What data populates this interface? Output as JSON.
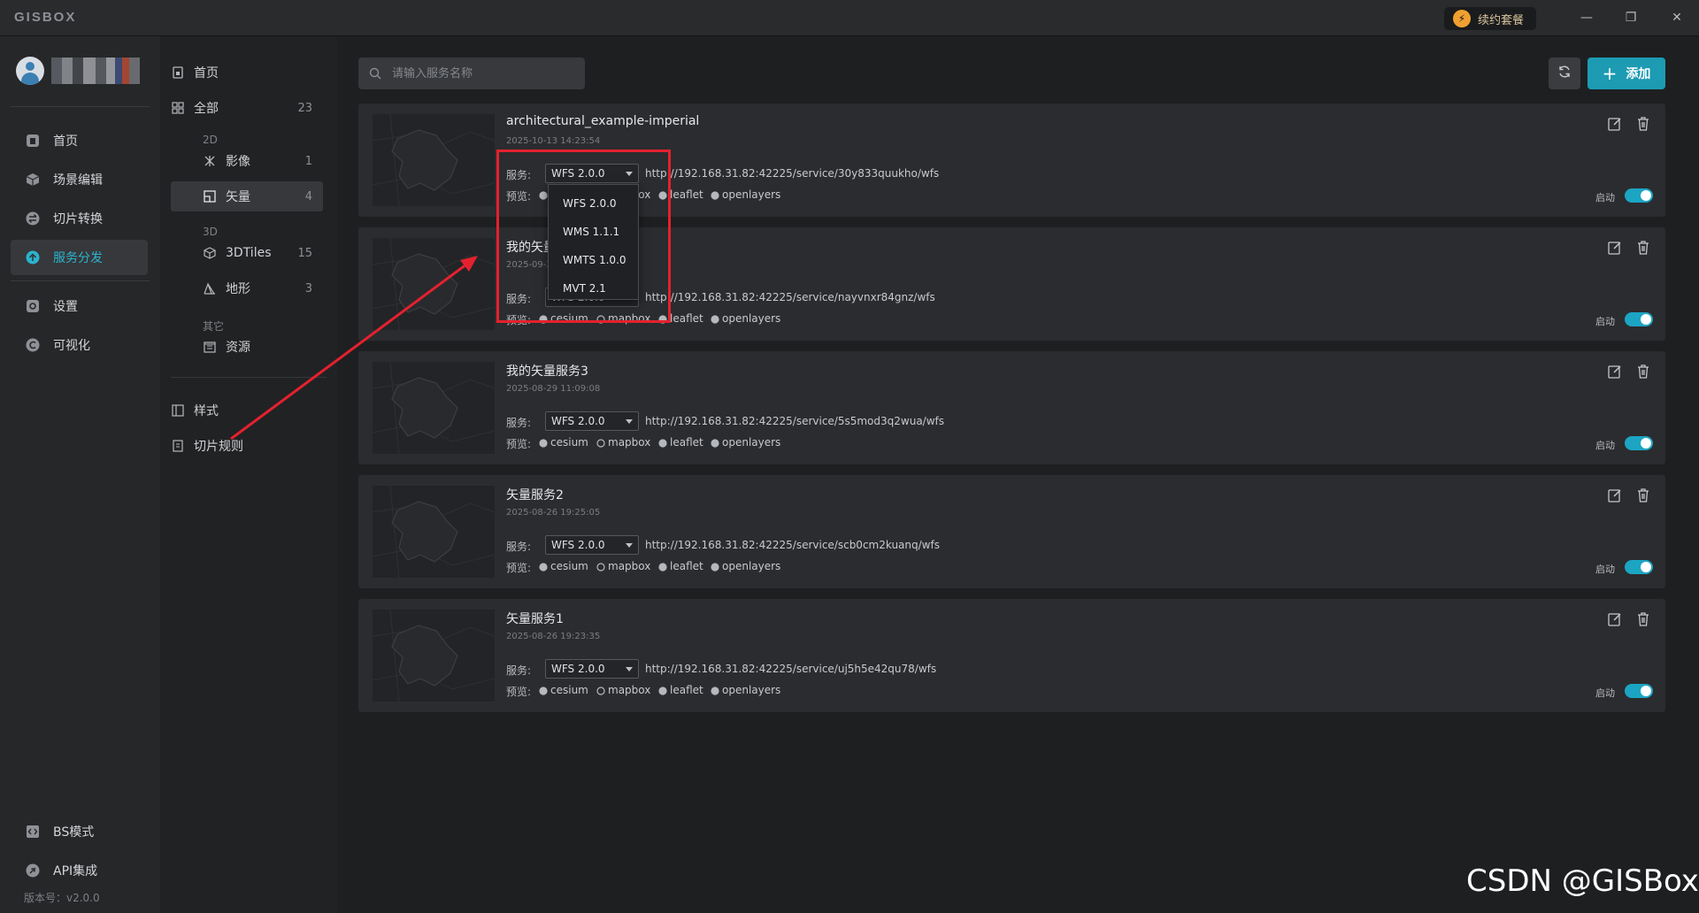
{
  "app": {
    "logo": "GISBOX",
    "renew_label": "续约套餐"
  },
  "window": {
    "minimize": "—",
    "restore": "❐",
    "close": "✕"
  },
  "nav": {
    "items": [
      {
        "label": "首页",
        "icon": "home-icon"
      },
      {
        "label": "场景编辑",
        "icon": "cube-icon"
      },
      {
        "label": "切片转换",
        "icon": "convert-icon"
      },
      {
        "label": "服务分发",
        "icon": "upload-icon"
      },
      {
        "label": "设置",
        "icon": "gear-icon"
      },
      {
        "label": "可视化",
        "icon": "visual-icon"
      }
    ],
    "bottom": [
      {
        "label": "BS模式",
        "icon": "code-icon"
      },
      {
        "label": "API集成",
        "icon": "api-icon"
      }
    ],
    "version": "版本号：v2.0.0"
  },
  "categories": {
    "home": "首页",
    "all": {
      "label": "全部",
      "count": "23"
    },
    "group_2d": "2D",
    "imagery": {
      "label": "影像",
      "count": "1"
    },
    "vector": {
      "label": "矢量",
      "count": "4"
    },
    "group_3d": "3D",
    "tiles3d": {
      "label": "3DTiles",
      "count": "15"
    },
    "terrain": {
      "label": "地形",
      "count": "3"
    },
    "group_other": "其它",
    "resource": "资源",
    "style": "样式",
    "tile_rules": "切片规则"
  },
  "toolbar": {
    "search_placeholder": "请输入服务名称",
    "add_label": "添加"
  },
  "labels": {
    "service": "服务:",
    "preview": "预览:",
    "enable": "启动"
  },
  "preview_engines": [
    "cesium",
    "mapbox",
    "leaflet",
    "openlayers"
  ],
  "services": [
    {
      "title": "architectural_example-imperial",
      "date": "2025-10-13 14:23:54",
      "protocol": "WFS 2.0.0",
      "url": "http://192.168.31.82:42225/service/30y833quukho/wfs",
      "enabled": true
    },
    {
      "title": "我的矢量服务4",
      "date": "2025-09-2",
      "protocol": "WFS 2.0.0",
      "url": "http://192.168.31.82:42225/service/nayvnxr84gnz/wfs",
      "enabled": true
    },
    {
      "title": "我的矢量服务3",
      "date": "2025-08-29 11:09:08",
      "protocol": "WFS 2.0.0",
      "url": "http://192.168.31.82:42225/service/5s5mod3q2wua/wfs",
      "enabled": true
    },
    {
      "title": "矢量服务2",
      "date": "2025-08-26 19:25:05",
      "protocol": "WFS 2.0.0",
      "url": "http://192.168.31.82:42225/service/scb0cm2kuanq/wfs",
      "enabled": true
    },
    {
      "title": "矢量服务1",
      "date": "2025-08-26 19:23:35",
      "protocol": "WFS 2.0.0",
      "url": "http://192.168.31.82:42225/service/uj5h5e42qu78/wfs",
      "enabled": true
    }
  ],
  "dropdown": {
    "options": [
      "WFS 2.0.0",
      "WMS 1.1.1",
      "WMTS 1.0.0",
      "MVT 2.1"
    ]
  },
  "watermark": "CSDN @GISBox",
  "colors": {
    "accent": "#1c9bb3",
    "toggle": "#1ca5c3",
    "annotation": "#e4212e"
  }
}
